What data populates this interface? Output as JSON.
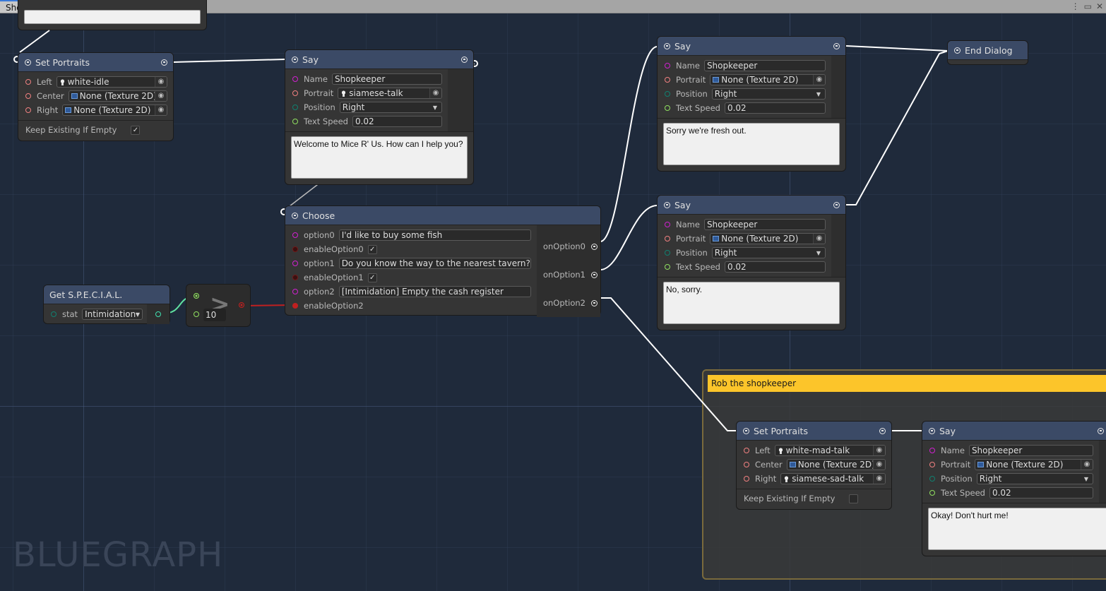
{
  "window": {
    "tab_title": "Shopkeeper Dialog Tree",
    "controls": [
      "more-icon",
      "maximize-icon",
      "close-icon"
    ]
  },
  "watermark": "BLUEGRAPH",
  "colors": {
    "canvas_bg": "#1f2a3b",
    "node_header": "#3b4a66",
    "node_body": "#353535",
    "group_title_bg": "#fcc52a",
    "wire_exec": "#ffffff",
    "wire_float": "#90e060",
    "wire_bool": "#c02020"
  },
  "nodes": {
    "set_portraits_1": {
      "title": "Set Portraits",
      "left_label": "Left",
      "left_value": "white-idle",
      "center_label": "Center",
      "center_value": "None (Texture 2D)",
      "right_label": "Right",
      "right_value": "None (Texture 2D)",
      "keep_label": "Keep Existing If Empty",
      "keep_checked": true
    },
    "say_1": {
      "title": "Say",
      "name_label": "Name",
      "name_value": "Shopkeeper",
      "portrait_label": "Portrait",
      "portrait_value": "siamese-talk",
      "position_label": "Position",
      "position_value": "Right",
      "speed_label": "Text Speed",
      "speed_value": "0.02",
      "text": "Welcome to Mice R' Us. How can I help you?"
    },
    "choose": {
      "title": "Choose",
      "option0_label": "option0",
      "option0_value": "I'd like to buy some fish",
      "enable0_label": "enableOption0",
      "enable0_checked": true,
      "option1_label": "option1",
      "option1_value": "Do you know the way to the nearest tavern?",
      "enable1_label": "enableOption1",
      "enable1_checked": true,
      "option2_label": "option2",
      "option2_value": "[Intimidation] Empty the cash register",
      "enable2_label": "enableOption2",
      "out0": "onOption0",
      "out1": "onOption1",
      "out2": "onOption2"
    },
    "get_special": {
      "title": "Get S.P.E.C.I.A.L.",
      "stat_label": "stat",
      "stat_value": "Intimidation"
    },
    "compare": {
      "operator": ">",
      "value": "10"
    },
    "say_2": {
      "title": "Say",
      "name_label": "Name",
      "name_value": "Shopkeeper",
      "portrait_label": "Portrait",
      "portrait_value": "None (Texture 2D)",
      "position_label": "Position",
      "position_value": "Right",
      "speed_label": "Text Speed",
      "speed_value": "0.02",
      "text": "Sorry we're fresh out."
    },
    "say_3": {
      "title": "Say",
      "name_label": "Name",
      "name_value": "Shopkeeper",
      "portrait_label": "Portrait",
      "portrait_value": "None (Texture 2D)",
      "position_label": "Position",
      "position_value": "Right",
      "speed_label": "Text Speed",
      "speed_value": "0.02",
      "text": "No, sorry."
    },
    "end_dialog": {
      "title": "End Dialog"
    },
    "group": {
      "title": "Rob the shopkeeper"
    },
    "set_portraits_2": {
      "title": "Set Portraits",
      "left_label": "Left",
      "left_value": "white-mad-talk",
      "center_label": "Center",
      "center_value": "None (Texture 2D)",
      "right_label": "Right",
      "right_value": "siamese-sad-talk",
      "keep_label": "Keep Existing If Empty",
      "keep_checked": false
    },
    "say_4": {
      "title": "Say",
      "name_label": "Name",
      "name_value": "Shopkeeper",
      "portrait_label": "Portrait",
      "portrait_value": "None (Texture 2D)",
      "position_label": "Position",
      "position_value": "Right",
      "speed_label": "Text Speed",
      "speed_value": "0.02",
      "text": "Okay! Don't hurt me!"
    }
  }
}
